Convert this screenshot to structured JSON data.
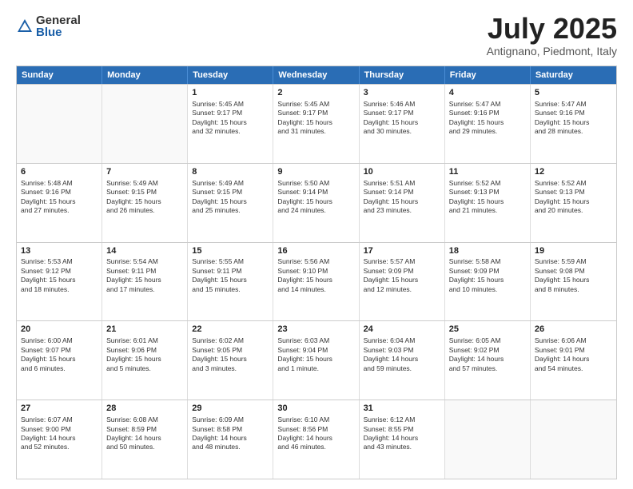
{
  "logo": {
    "general": "General",
    "blue": "Blue"
  },
  "title": "July 2025",
  "subtitle": "Antignano, Piedmont, Italy",
  "days": [
    "Sunday",
    "Monday",
    "Tuesday",
    "Wednesday",
    "Thursday",
    "Friday",
    "Saturday"
  ],
  "weeks": [
    [
      {
        "day": "",
        "info": ""
      },
      {
        "day": "",
        "info": ""
      },
      {
        "day": "1",
        "info": "Sunrise: 5:45 AM\nSunset: 9:17 PM\nDaylight: 15 hours\nand 32 minutes."
      },
      {
        "day": "2",
        "info": "Sunrise: 5:45 AM\nSunset: 9:17 PM\nDaylight: 15 hours\nand 31 minutes."
      },
      {
        "day": "3",
        "info": "Sunrise: 5:46 AM\nSunset: 9:17 PM\nDaylight: 15 hours\nand 30 minutes."
      },
      {
        "day": "4",
        "info": "Sunrise: 5:47 AM\nSunset: 9:16 PM\nDaylight: 15 hours\nand 29 minutes."
      },
      {
        "day": "5",
        "info": "Sunrise: 5:47 AM\nSunset: 9:16 PM\nDaylight: 15 hours\nand 28 minutes."
      }
    ],
    [
      {
        "day": "6",
        "info": "Sunrise: 5:48 AM\nSunset: 9:16 PM\nDaylight: 15 hours\nand 27 minutes."
      },
      {
        "day": "7",
        "info": "Sunrise: 5:49 AM\nSunset: 9:15 PM\nDaylight: 15 hours\nand 26 minutes."
      },
      {
        "day": "8",
        "info": "Sunrise: 5:49 AM\nSunset: 9:15 PM\nDaylight: 15 hours\nand 25 minutes."
      },
      {
        "day": "9",
        "info": "Sunrise: 5:50 AM\nSunset: 9:14 PM\nDaylight: 15 hours\nand 24 minutes."
      },
      {
        "day": "10",
        "info": "Sunrise: 5:51 AM\nSunset: 9:14 PM\nDaylight: 15 hours\nand 23 minutes."
      },
      {
        "day": "11",
        "info": "Sunrise: 5:52 AM\nSunset: 9:13 PM\nDaylight: 15 hours\nand 21 minutes."
      },
      {
        "day": "12",
        "info": "Sunrise: 5:52 AM\nSunset: 9:13 PM\nDaylight: 15 hours\nand 20 minutes."
      }
    ],
    [
      {
        "day": "13",
        "info": "Sunrise: 5:53 AM\nSunset: 9:12 PM\nDaylight: 15 hours\nand 18 minutes."
      },
      {
        "day": "14",
        "info": "Sunrise: 5:54 AM\nSunset: 9:11 PM\nDaylight: 15 hours\nand 17 minutes."
      },
      {
        "day": "15",
        "info": "Sunrise: 5:55 AM\nSunset: 9:11 PM\nDaylight: 15 hours\nand 15 minutes."
      },
      {
        "day": "16",
        "info": "Sunrise: 5:56 AM\nSunset: 9:10 PM\nDaylight: 15 hours\nand 14 minutes."
      },
      {
        "day": "17",
        "info": "Sunrise: 5:57 AM\nSunset: 9:09 PM\nDaylight: 15 hours\nand 12 minutes."
      },
      {
        "day": "18",
        "info": "Sunrise: 5:58 AM\nSunset: 9:09 PM\nDaylight: 15 hours\nand 10 minutes."
      },
      {
        "day": "19",
        "info": "Sunrise: 5:59 AM\nSunset: 9:08 PM\nDaylight: 15 hours\nand 8 minutes."
      }
    ],
    [
      {
        "day": "20",
        "info": "Sunrise: 6:00 AM\nSunset: 9:07 PM\nDaylight: 15 hours\nand 6 minutes."
      },
      {
        "day": "21",
        "info": "Sunrise: 6:01 AM\nSunset: 9:06 PM\nDaylight: 15 hours\nand 5 minutes."
      },
      {
        "day": "22",
        "info": "Sunrise: 6:02 AM\nSunset: 9:05 PM\nDaylight: 15 hours\nand 3 minutes."
      },
      {
        "day": "23",
        "info": "Sunrise: 6:03 AM\nSunset: 9:04 PM\nDaylight: 15 hours\nand 1 minute."
      },
      {
        "day": "24",
        "info": "Sunrise: 6:04 AM\nSunset: 9:03 PM\nDaylight: 14 hours\nand 59 minutes."
      },
      {
        "day": "25",
        "info": "Sunrise: 6:05 AM\nSunset: 9:02 PM\nDaylight: 14 hours\nand 57 minutes."
      },
      {
        "day": "26",
        "info": "Sunrise: 6:06 AM\nSunset: 9:01 PM\nDaylight: 14 hours\nand 54 minutes."
      }
    ],
    [
      {
        "day": "27",
        "info": "Sunrise: 6:07 AM\nSunset: 9:00 PM\nDaylight: 14 hours\nand 52 minutes."
      },
      {
        "day": "28",
        "info": "Sunrise: 6:08 AM\nSunset: 8:59 PM\nDaylight: 14 hours\nand 50 minutes."
      },
      {
        "day": "29",
        "info": "Sunrise: 6:09 AM\nSunset: 8:58 PM\nDaylight: 14 hours\nand 48 minutes."
      },
      {
        "day": "30",
        "info": "Sunrise: 6:10 AM\nSunset: 8:56 PM\nDaylight: 14 hours\nand 46 minutes."
      },
      {
        "day": "31",
        "info": "Sunrise: 6:12 AM\nSunset: 8:55 PM\nDaylight: 14 hours\nand 43 minutes."
      },
      {
        "day": "",
        "info": ""
      },
      {
        "day": "",
        "info": ""
      }
    ]
  ]
}
